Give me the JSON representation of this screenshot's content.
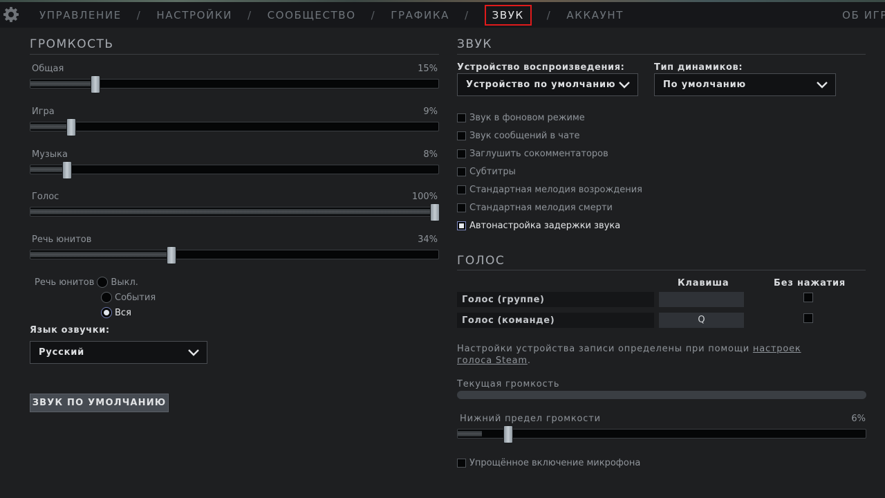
{
  "nav": {
    "items": [
      "УПРАВЛЕНИЕ",
      "НАСТРОЙКИ",
      "СООБЩЕСТВО",
      "ГРАФИКА",
      "ЗВУК",
      "АККАУНТ"
    ],
    "active": "ЗВУК",
    "separator": "/",
    "right": "ОБ ИГР"
  },
  "volume": {
    "title": "ГРОМКОСТЬ",
    "sliders": [
      {
        "label": "Общая",
        "value_text": "15%",
        "value": 15
      },
      {
        "label": "Игра",
        "value_text": "9%",
        "value": 9
      },
      {
        "label": "Музыка",
        "value_text": "8%",
        "value": 8
      },
      {
        "label": "Голос",
        "value_text": "100%",
        "value": 100
      },
      {
        "label": "Речь юнитов",
        "value_text": "34%",
        "value": 34
      }
    ],
    "unit_speech": {
      "label": "Речь юнитов",
      "options": [
        "Выкл.",
        "События",
        "Вся"
      ],
      "selected": "Вся"
    },
    "voice_language": {
      "label": "Язык озвучки:",
      "value": "Русский"
    },
    "default_button": "ЗВУК ПО УМОЛЧАНИЮ"
  },
  "sound": {
    "title": "ЗВУК",
    "playback_device": {
      "label": "Устройство воспроизведения:",
      "value": "Устройство по умолчанию"
    },
    "speaker_type": {
      "label": "Тип динамиков:",
      "value": "По умолчанию"
    },
    "checkboxes": [
      {
        "label": "Звук в фоновом режиме",
        "checked": false
      },
      {
        "label": "Звук сообщений в чате",
        "checked": false
      },
      {
        "label": "Заглушить сокомментаторов",
        "checked": false
      },
      {
        "label": "Субтитры",
        "checked": false
      },
      {
        "label": "Стандартная мелодия возрождения",
        "checked": false
      },
      {
        "label": "Стандартная мелодия смерти",
        "checked": false
      },
      {
        "label": "Автонастройка задержки звука",
        "checked": true
      }
    ]
  },
  "voice": {
    "title": "ГОЛОС",
    "col_key": "Клавиша",
    "col_open": "Без нажатия",
    "rows": [
      {
        "label": "Голос (группе)",
        "key": "",
        "open": false
      },
      {
        "label": "Голос (команде)",
        "key": "Q",
        "open": false
      }
    ],
    "note_text": "Настройки устройства записи определены при помощи ",
    "note_link1": "настроек",
    "note_link2": "голоса Steam",
    "note_end": ".",
    "current_volume_label": "Текущая громкость",
    "current_volume_level": 0,
    "threshold": {
      "label": "Нижний предел громкости",
      "value_text": "6%",
      "value": 6
    },
    "simplified_mic": {
      "label": "Упрощённое включение микрофона",
      "checked": false
    }
  },
  "colors": {
    "background": "#1e1f21",
    "active_tab_border": "#e01b1b",
    "checkbox_active": "#7e8ac4"
  },
  "icons": {
    "settings": "gear-icon",
    "dropdown": "chevron-down-icon"
  }
}
